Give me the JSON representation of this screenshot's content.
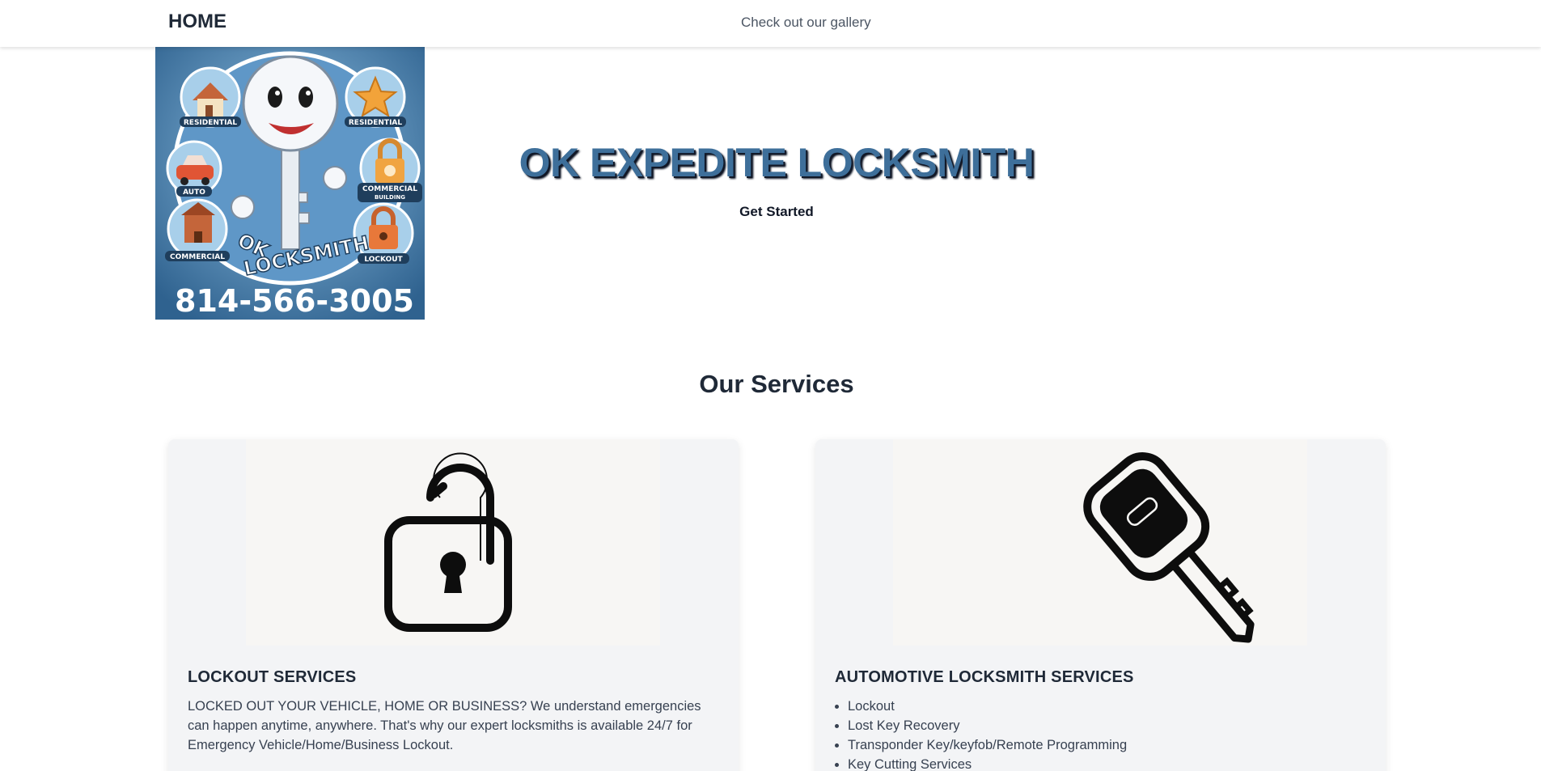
{
  "nav": {
    "home_label": "HOME",
    "gallery_label": "Check out our gallery"
  },
  "hero": {
    "title": "OK EXPEDITE LOCKSMITH",
    "cta_label": "Get Started",
    "logo": {
      "phone": "814-566-3005",
      "brand_top": "OK",
      "brand_bottom": "LOCKSMITH",
      "badges": [
        "RESIDENTIAL",
        "RESIDENTIAL",
        "AUTO",
        "COMMERCIAL BUILDING",
        "COMMERCIAL",
        "LOCKOUT"
      ]
    }
  },
  "services": {
    "heading": "Our Services",
    "cards": [
      {
        "icon": "open-padlock-icon",
        "title": "LOCKOUT SERVICES",
        "text": "LOCKED OUT YOUR VEHICLE, HOME OR BUSINESS? We understand emergencies can happen anytime, anywhere. That's why our expert locksmiths is available 24/7 for Emergency Vehicle/Home/Business Lockout."
      },
      {
        "icon": "car-key-icon",
        "title": "AUTOMOTIVE LOCKSMITH SERVICES",
        "items": [
          "Lockout",
          "Lost Key Recovery",
          "Transponder Key/keyfob/Remote Programming",
          "Key Cutting Services"
        ]
      }
    ]
  },
  "colors": {
    "title_blue": "#3e6f9a",
    "logo_bg": "#4a82b4",
    "card_bg": "#f3f4f6",
    "text_dark": "#1f2937"
  }
}
